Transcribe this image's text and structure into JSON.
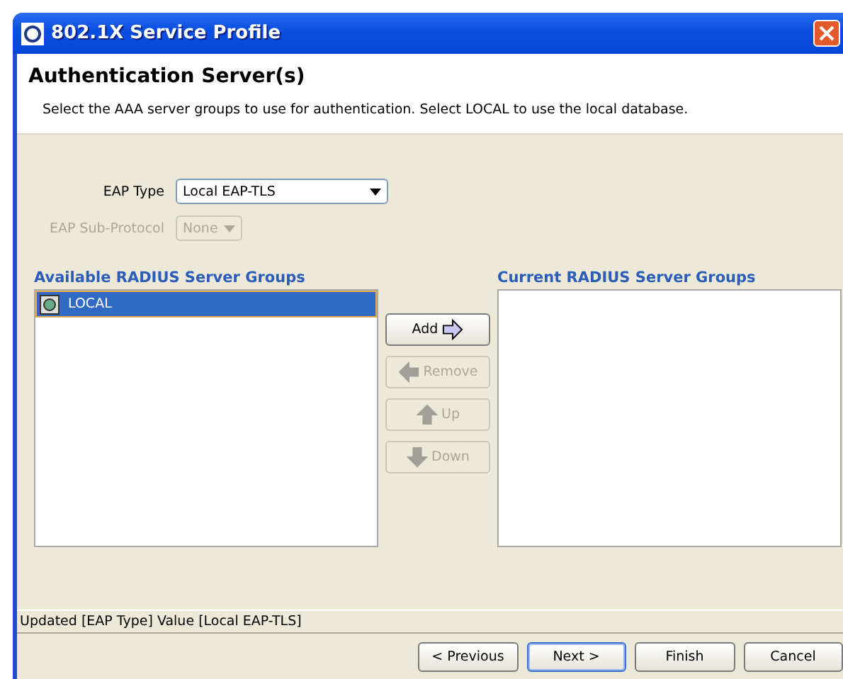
{
  "window": {
    "title": "802.1X Service Profile"
  },
  "header": {
    "title": "Authentication Server(s)",
    "description": "Select the AAA server groups to use for authentication. Select LOCAL to use the local database."
  },
  "fields": [
    {
      "label": "EAP Type",
      "value": "Local EAP-TLS",
      "disabled": false
    },
    {
      "label": "EAP Sub-Protocol",
      "value": "None",
      "disabled": true
    }
  ],
  "available": {
    "title": "Available RADIUS Server Groups",
    "items": [
      {
        "label": "LOCAL",
        "selected": true
      }
    ]
  },
  "current": {
    "title": "Current RADIUS Server Groups"
  },
  "move_buttons": [
    {
      "label": "Add",
      "kind": "right",
      "disabled": false
    },
    {
      "label": "Remove",
      "kind": "left",
      "disabled": true
    },
    {
      "label": "Up",
      "kind": "up",
      "disabled": true
    },
    {
      "label": "Down",
      "kind": "down",
      "disabled": true
    }
  ],
  "status_bar": "Updated [EAP Type] Value [Local EAP-TLS]",
  "buttons": [
    {
      "label": "< Previous",
      "selected": false
    },
    {
      "label": "Next >",
      "selected": true
    },
    {
      "label": "Finish",
      "selected": false
    },
    {
      "label": "Cancel",
      "selected": false
    }
  ]
}
